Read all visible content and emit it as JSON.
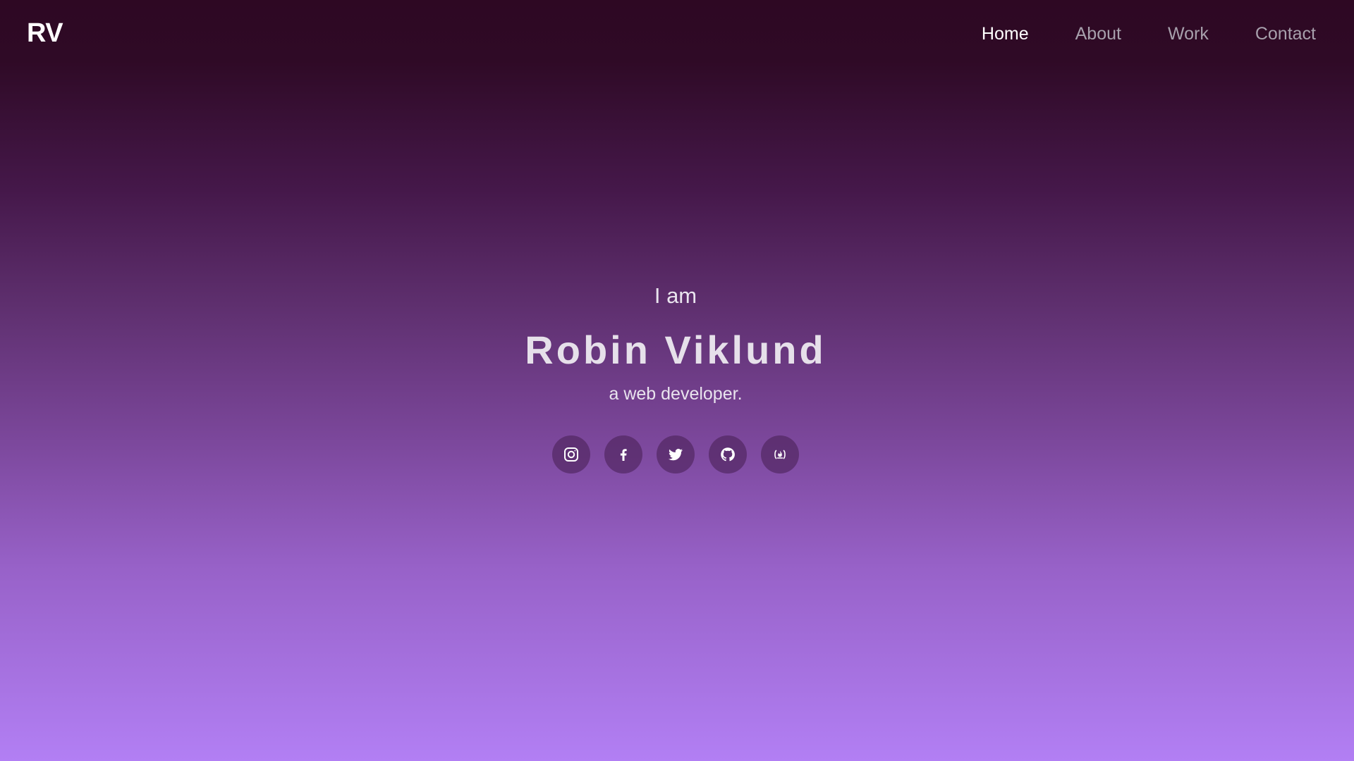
{
  "header": {
    "logo": "RV",
    "nav": [
      {
        "label": "Home",
        "active": true
      },
      {
        "label": "About",
        "active": false
      },
      {
        "label": "Work",
        "active": false
      },
      {
        "label": "Contact",
        "active": false
      }
    ]
  },
  "hero": {
    "intro": "I am",
    "name": "Robin Viklund",
    "role": "a web developer."
  },
  "socials": [
    {
      "icon": "instagram-icon"
    },
    {
      "icon": "facebook-icon"
    },
    {
      "icon": "twitter-icon"
    },
    {
      "icon": "github-icon"
    },
    {
      "icon": "freecodecamp-icon"
    }
  ],
  "colors": {
    "gradient_top": "#2e0823",
    "gradient_bottom": "#b27ff4",
    "nav_active": "#ffffff",
    "nav_inactive": "#a7a0ac"
  }
}
